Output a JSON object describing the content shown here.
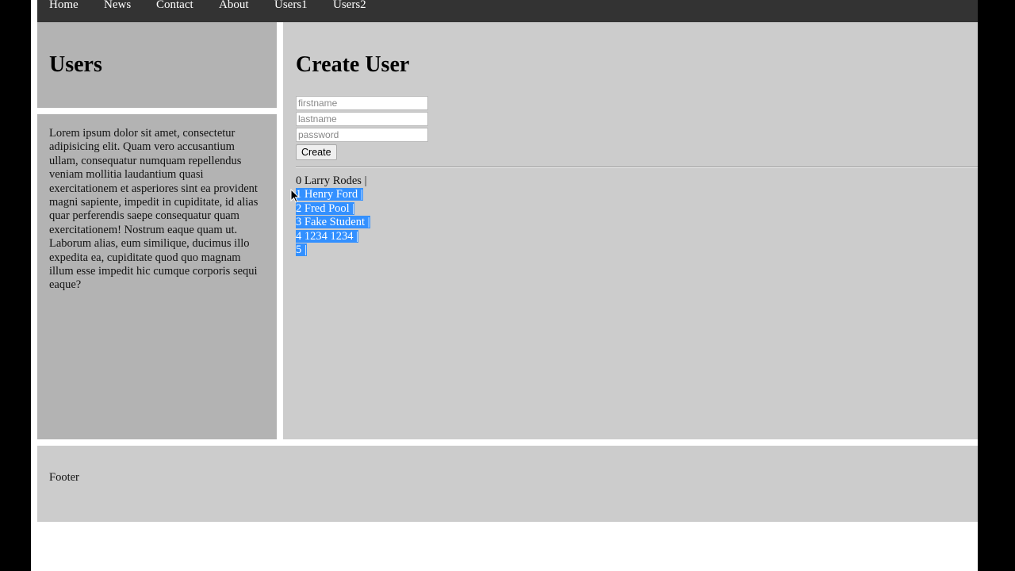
{
  "nav": {
    "items": [
      "Home",
      "News",
      "Contact",
      "About",
      "Users1",
      "Users2"
    ]
  },
  "sidebar": {
    "title": "Users",
    "text": "Lorem ipsum dolor sit amet, consectetur adipisicing elit. Quam vero accusantium ullam, consequatur numquam repellendus veniam mollitia laudantium quasi exercitationem et asperiores sint ea provident magni sapiente, impedit in cupiditate, id alias quar perferendis saepe consequatur quam exercitationem! Nostrum eaque quam ut. Laborum alias, eum similique, ducimus illo expedita ea, cupiditate quod quo magnam illum esse impedit hic cumque corporis sequi eaque?"
  },
  "main": {
    "title": "Create User",
    "form": {
      "firstname_placeholder": "firstname",
      "lastname_placeholder": "lastname",
      "password_placeholder": "password",
      "firstname_value": "",
      "lastname_value": "",
      "password_value": "",
      "create_label": "Create"
    },
    "users": [
      {
        "text": "0 Larry Rodes |",
        "selected": false
      },
      {
        "text": "1 Henry Ford |",
        "selected": true
      },
      {
        "text": "2 Fred Pool |",
        "selected": true
      },
      {
        "text": "3 Fake Student |",
        "selected": true
      },
      {
        "text": "4 1234 1234 |",
        "selected": true
      },
      {
        "text": "5 |",
        "selected": true
      }
    ]
  },
  "footer": {
    "text": "Footer"
  },
  "colors": {
    "nav_bg": "#333333",
    "sidebar_bg": "#b3b3b3",
    "main_bg": "#cccccc",
    "selection": "#3390ff"
  },
  "icons": {
    "cursor": "mouse-pointer-icon"
  }
}
